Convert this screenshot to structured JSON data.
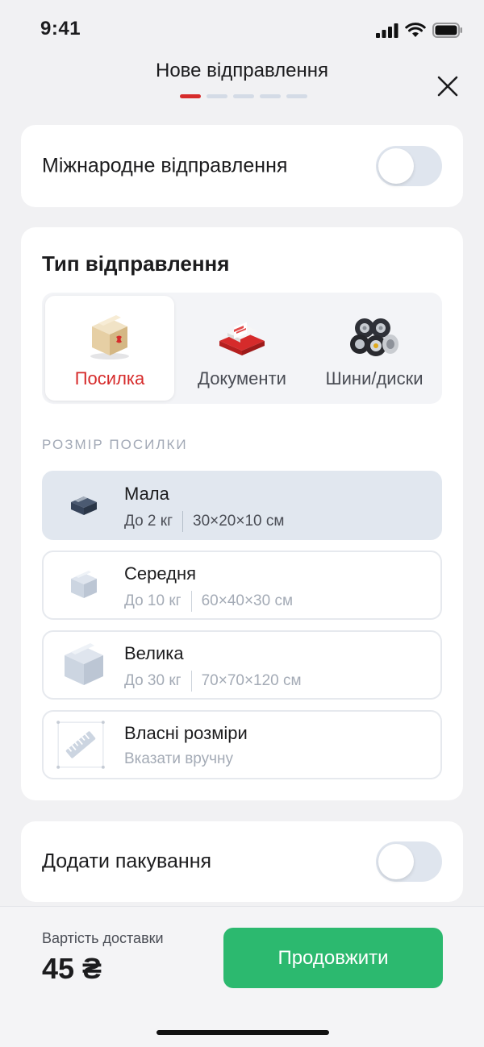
{
  "status_bar": {
    "time": "9:41"
  },
  "header": {
    "title": "Нове відправлення",
    "steps_total": 5,
    "steps_active": 1
  },
  "international": {
    "label": "Міжнародне відправлення",
    "enabled": false
  },
  "shipment_type": {
    "title": "Тип відправлення",
    "options": [
      {
        "label": "Посилка",
        "icon": "parcel-box-icon",
        "selected": true
      },
      {
        "label": "Документи",
        "icon": "documents-icon",
        "selected": false
      },
      {
        "label": "Шини/диски",
        "icon": "tires-icon",
        "selected": false
      }
    ]
  },
  "parcel_size": {
    "heading": "РОЗМІР ПОСИЛКИ",
    "options": [
      {
        "name": "Мала",
        "weight": "До 2 кг",
        "dims": "30×20×10 см",
        "icon": "small-box-icon",
        "selected": true
      },
      {
        "name": "Середня",
        "weight": "До 10 кг",
        "dims": "60×40×30 см",
        "icon": "medium-box-icon",
        "selected": false
      },
      {
        "name": "Велика",
        "weight": "До 30 кг",
        "dims": "70×70×120 см",
        "icon": "large-box-icon",
        "selected": false
      },
      {
        "name": "Власні розміри",
        "hint": "Вказати вручну",
        "icon": "ruler-icon",
        "selected": false
      }
    ]
  },
  "packaging": {
    "label": "Додати пакування",
    "enabled": false
  },
  "footer": {
    "cost_label": "Вартість доставки",
    "cost_value": "45 ₴",
    "continue_label": "Продовжити"
  },
  "colors": {
    "accent_red": "#d62b2b",
    "primary_green": "#2cb96f",
    "selected_row_bg": "#e1e7ef",
    "toggle_off": "#dfe5ee"
  }
}
